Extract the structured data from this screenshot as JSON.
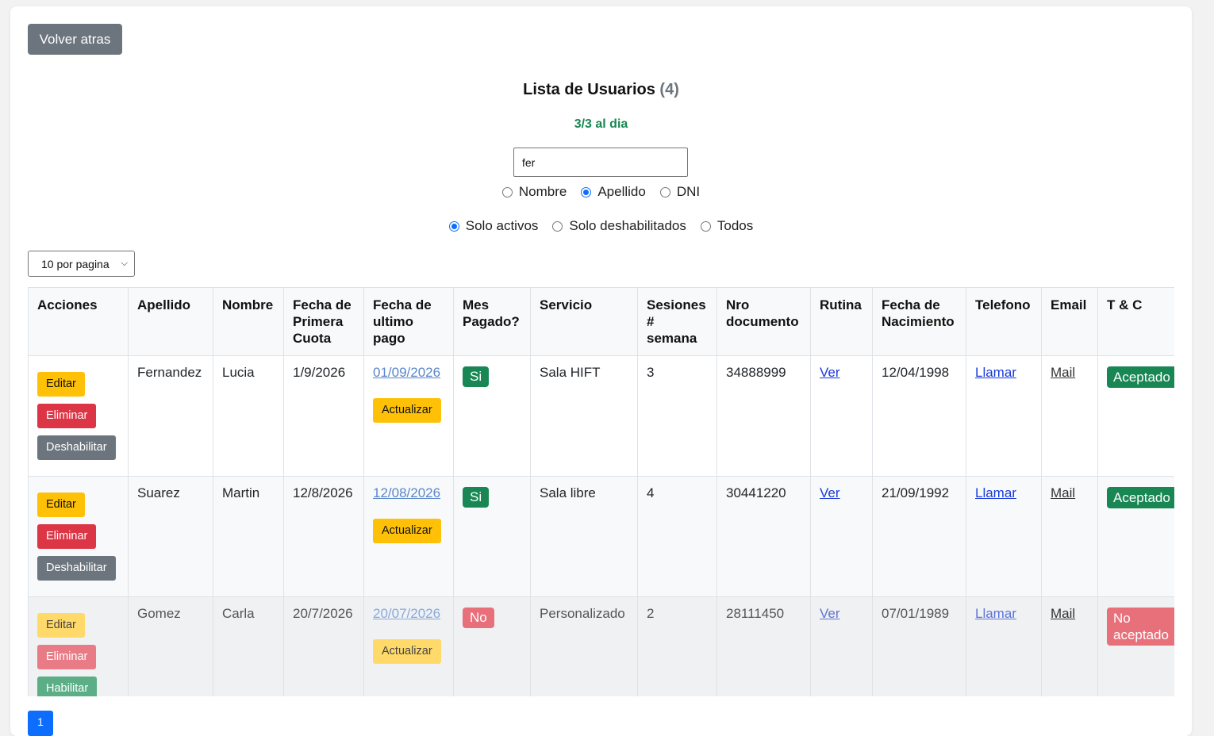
{
  "back_label": "Volver atras",
  "title": "Lista de Usuarios",
  "count": "(4)",
  "summary": "3/3 al dia",
  "search_value": "fer",
  "search_by": [
    {
      "label": "Nombre",
      "selected": false
    },
    {
      "label": "Apellido",
      "selected": true
    },
    {
      "label": "DNI",
      "selected": false
    }
  ],
  "status_filter": [
    {
      "label": "Solo activos",
      "selected": true
    },
    {
      "label": "Solo deshabilitados",
      "selected": false
    },
    {
      "label": "Todos",
      "selected": false
    }
  ],
  "page_size": "10 por pagina",
  "headers": [
    "Acciones",
    "Apellido",
    "Nombre",
    "Fecha de Primera Cuota",
    "Fecha de ultimo pago",
    "Mes Pagado?",
    "Servicio",
    "Sesiones # semana",
    "Nro documento",
    "Rutina",
    "Fecha de Nacimiento",
    "Telefono",
    "Email",
    "T & C"
  ],
  "action_labels": {
    "edit": "Editar",
    "delete": "Eliminar",
    "disable": "Deshabilitar",
    "enable": "Habilitar",
    "update": "Actualizar"
  },
  "rows": [
    {
      "apellido": "Fernandez",
      "nombre": "Lucia",
      "primera_cuota": "1/9/2026",
      "ultimo_pago": "01/09/2026",
      "mes_pagado": "Si",
      "servicio": "Sala HIFT",
      "sesiones": "3",
      "documento": "34888999",
      "rutina": "Ver",
      "nacimiento": "12/04/1998",
      "telefono": "Llamar",
      "email": "Mail",
      "tc": "Aceptado",
      "toggle": "Deshabilitar"
    },
    {
      "apellido": "Suarez",
      "nombre": "Martin",
      "primera_cuota": "12/8/2026",
      "ultimo_pago": "12/08/2026",
      "mes_pagado": "Si",
      "servicio": "Sala libre",
      "sesiones": "4",
      "documento": "30441220",
      "rutina": "Ver",
      "nacimiento": "21/09/1992",
      "telefono": "Llamar",
      "email": "Mail",
      "tc": "Aceptado",
      "toggle": "Deshabilitar"
    },
    {
      "apellido": "Gomez",
      "nombre": "Carla",
      "primera_cuota": "20/7/2026",
      "ultimo_pago": "20/07/2026",
      "mes_pagado": "No",
      "servicio": "Personalizado",
      "sesiones": "2",
      "documento": "28111450",
      "rutina": "Ver",
      "nacimiento": "07/01/1989",
      "telefono": "Llamar",
      "email": "Mail",
      "tc": "No aceptado",
      "toggle": "Habilitar"
    }
  ],
  "current_page": "1",
  "colors": {
    "accent": "#0d6efd",
    "success": "#198754",
    "danger": "#dc3545",
    "warning": "#ffc107",
    "secondary": "#6c757d"
  }
}
